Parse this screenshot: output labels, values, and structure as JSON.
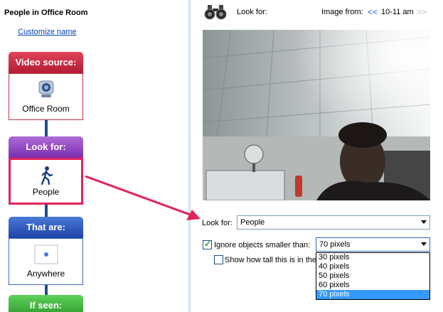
{
  "rule": {
    "title": "People in Office Room",
    "customize_link": "Customize name"
  },
  "blocks": {
    "video_source": {
      "header": "Video source:",
      "label": "Office Room"
    },
    "look_for": {
      "header": "Look for:",
      "label": "People"
    },
    "that_are": {
      "header": "That are:",
      "label": "Anywhere"
    },
    "if_seen": {
      "header": "If seen:"
    }
  },
  "right": {
    "look_for_heading": "Look for:",
    "image_from_label": "Image from:",
    "nav_prev": "<<",
    "nav_time": "10-11 am",
    "nav_next": ">>",
    "look_for_label": "Look for:",
    "look_for_value": "People",
    "ignore_label": "Ignore objects smaller than:",
    "ignore_checked": true,
    "ignore_value": "70 pixels",
    "show_tall_label": "Show how tall this is in the",
    "show_tall_checked": false,
    "size_options": [
      "30 pixels",
      "40 pixels",
      "50 pixels",
      "60 pixels",
      "70 pixels"
    ],
    "selected_option_index": 4
  },
  "colors": {
    "video_source": "#c3344a",
    "look_for": "#7a2faf",
    "that_are": "#1f43a6",
    "if_seen": "#2e9a2a",
    "highlight": "#e0245a",
    "link": "#0645ad"
  },
  "icons": {
    "video_source": "webcam-icon",
    "look_for": "person-walking-icon",
    "that_are": "location-dot-icon",
    "header": "binoculars-icon"
  }
}
